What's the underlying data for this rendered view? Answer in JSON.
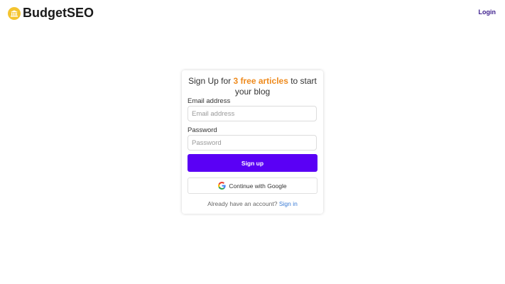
{
  "header": {
    "brand_name": "BudgetSEO",
    "login_label": "Login",
    "logo_icon": "coin-bank-icon",
    "logo_color": "#f4c430"
  },
  "signup": {
    "title_prefix": "Sign Up for ",
    "title_highlight": "3 free articles",
    "title_suffix": " to start your blog",
    "highlight_color": "#ee8a1d",
    "email_label": "Email address",
    "email_placeholder": "Email address",
    "email_value": "",
    "password_label": "Password",
    "password_placeholder": "Password",
    "password_value": "",
    "submit_label": "Sign up",
    "submit_color": "#5a00f5",
    "google_label": "Continue with Google",
    "google_icon": "google-icon",
    "account_prompt": "Already have an account?",
    "signin_label": "Sign in"
  }
}
